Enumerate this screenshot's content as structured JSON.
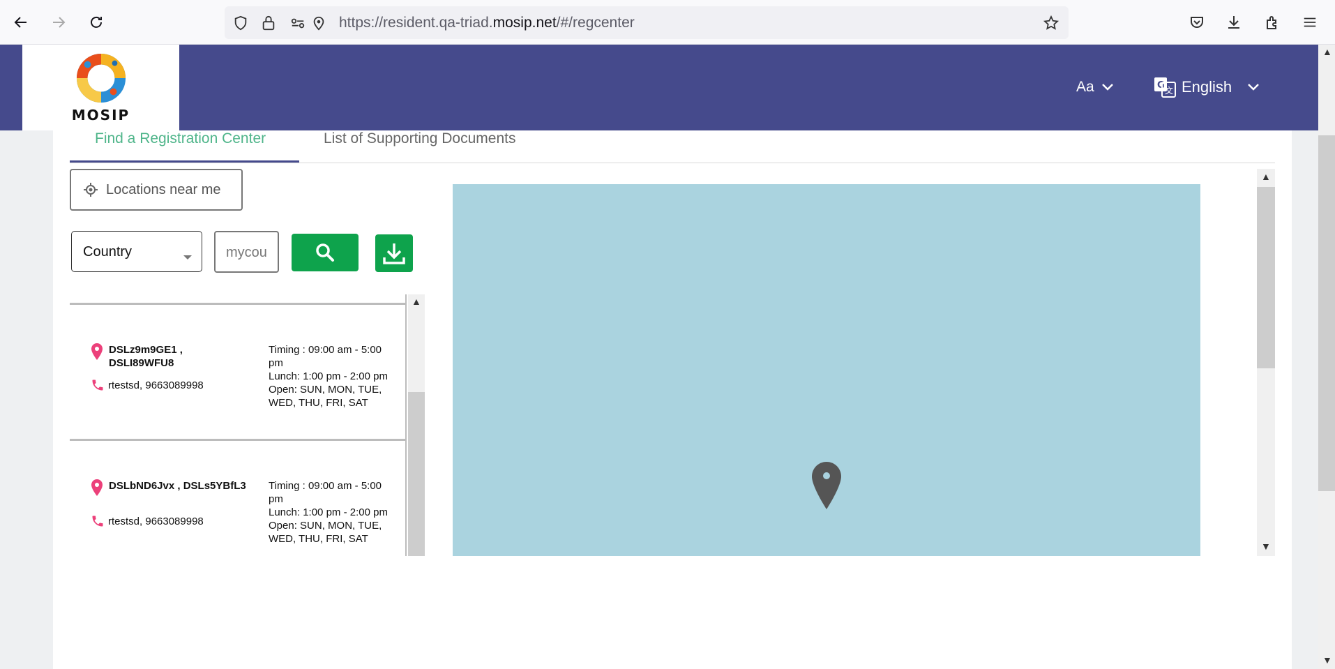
{
  "browser": {
    "url_prefix": "https://resident.qa-triad.",
    "url_domain": "mosip.net",
    "url_suffix": "/#/regcenter"
  },
  "header": {
    "logo_text": "MOSIP",
    "font_size_label": "Aa",
    "language_label": "English"
  },
  "tabs": [
    {
      "label": "Find a Registration Center",
      "active": true
    },
    {
      "label": "List of Supporting Documents",
      "active": false
    }
  ],
  "search": {
    "near_me_label": "Locations near me",
    "filter_selected": "Country",
    "input_value": "mycou"
  },
  "centers": [
    {
      "name": "DSLz9m9GE1 , DSLI89WFU8",
      "contact": "rtestsd, 9663089998",
      "timing": "Timing : 09:00 am - 5:00 pm",
      "lunch": "Lunch: 1:00 pm - 2:00 pm",
      "open": "Open: SUN, MON, TUE, WED, THU, FRI, SAT"
    },
    {
      "name": "DSLbND6Jvx , DSLs5YBfL3",
      "contact": "rtestsd, 9663089998",
      "timing": "Timing : 09:00 am - 5:00 pm",
      "lunch": "Lunch: 1:00 pm - 2:00 pm",
      "open": "Open: SUN, MON, TUE, WED, THU, FRI, SAT"
    }
  ],
  "colors": {
    "header_bg": "#454a8c",
    "active_tab": "#4fb58a",
    "button_green": "#0ea34c",
    "map_water": "#aad3df",
    "pin_pink": "#ec407a"
  }
}
